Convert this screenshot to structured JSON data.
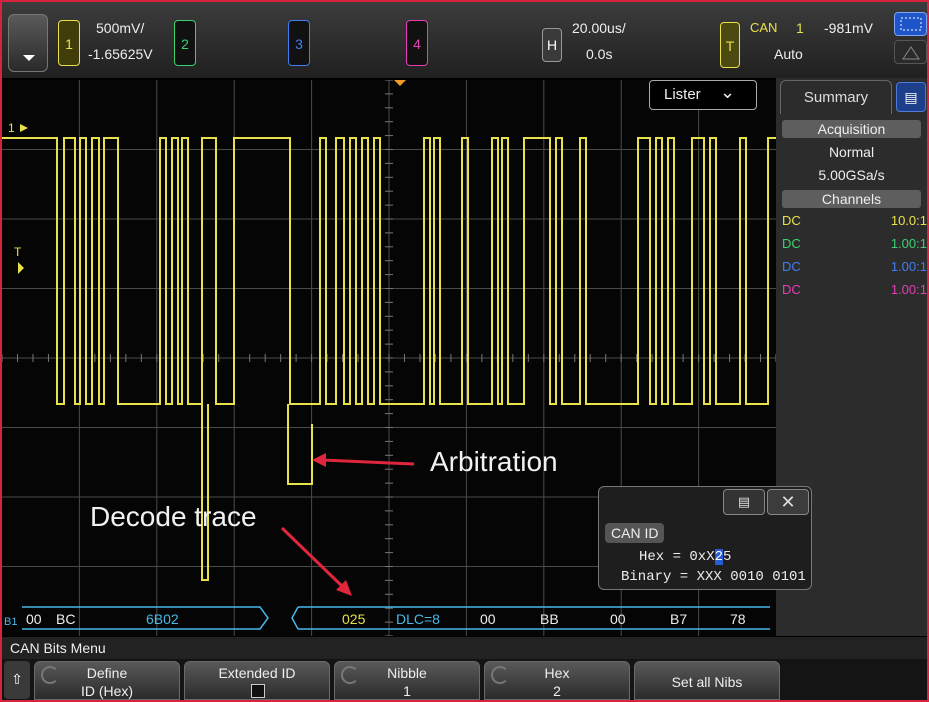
{
  "colors": {
    "ch1": "#e8e14a",
    "ch2": "#3bd16f",
    "ch3": "#3f7df0",
    "ch4": "#e43fb5",
    "bus": "#47b8e8",
    "annotation_arrow": "#e0263c"
  },
  "topbar": {
    "ch1": {
      "num": "1",
      "scale": "500mV/",
      "offset": "-1.65625V"
    },
    "ch2": {
      "num": "2"
    },
    "ch3": {
      "num": "3"
    },
    "ch4": {
      "num": "4"
    },
    "horizontal": {
      "label": "H",
      "timebase": "20.00us/",
      "delay": "0.0s"
    },
    "trigger": {
      "label": "T",
      "type": "CAN",
      "source": "1",
      "level": "-981mV",
      "mode": "Auto"
    }
  },
  "lister": {
    "label": "Lister",
    "chevron": "chevron-down-icon"
  },
  "summary": {
    "tab": "Summary",
    "acq_header": "Acquisition",
    "acq_mode": "Normal",
    "sample_rate": "5.00GSa/s",
    "channels_header": "Channels",
    "channels": [
      {
        "coupling": "DC",
        "probe": "10.0:1"
      },
      {
        "coupling": "DC",
        "probe": "1.00:1"
      },
      {
        "coupling": "DC",
        "probe": "1.00:1"
      },
      {
        "coupling": "DC",
        "probe": "1.00:1"
      }
    ]
  },
  "markers": {
    "ch1": "1",
    "trigger": "T"
  },
  "decode": {
    "bus_label": "B1",
    "fields": [
      "00",
      "BC",
      "6B02",
      "025",
      "DLC=8",
      "00",
      "BB",
      "00",
      "B7",
      "78"
    ]
  },
  "annotations": {
    "arbitration": "Arbitration",
    "decode_trace": "Decode trace"
  },
  "popup": {
    "title": "CAN ID",
    "hex_prefix": "Hex = 0xX",
    "hex_cursor": "2",
    "hex_suffix": "5",
    "binary": "Binary = XXX 0010 0101"
  },
  "menu": {
    "title": "CAN Bits Menu",
    "softkeys": [
      {
        "line1": "Define",
        "line2": "ID (Hex)"
      },
      {
        "line1": "Extended ID",
        "line2": ""
      },
      {
        "line1": "Nibble",
        "line2": "1"
      },
      {
        "line1": "Hex",
        "line2": "2"
      },
      {
        "line1": "Set all Nibs",
        "line2": ""
      }
    ]
  }
}
